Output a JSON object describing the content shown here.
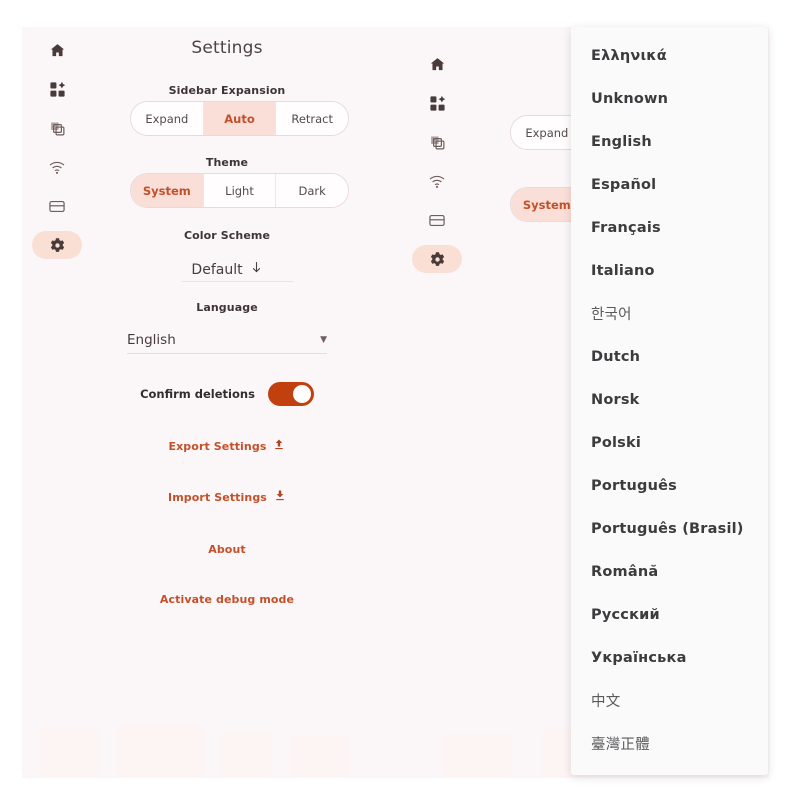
{
  "app": {
    "title": "Settings"
  },
  "sidebar": {
    "items": [
      {
        "name": "home",
        "icon": "home-icon",
        "active": false
      },
      {
        "name": "dashboard",
        "icon": "grid-dashboard-icon",
        "active": false
      },
      {
        "name": "library",
        "icon": "layers-copy-icon",
        "active": false
      },
      {
        "name": "network",
        "icon": "wifi-icon",
        "active": false
      },
      {
        "name": "billing",
        "icon": "credit-card-icon",
        "active": false
      },
      {
        "name": "settings",
        "icon": "gear-icon",
        "active": true
      }
    ]
  },
  "settings": {
    "sidebar_expansion": {
      "label": "Sidebar Expansion",
      "options": [
        "Expand",
        "Auto",
        "Retract"
      ],
      "selected": "Auto"
    },
    "theme": {
      "label": "Theme",
      "options": [
        "System",
        "Light",
        "Dark"
      ],
      "selected": "System"
    },
    "color_scheme": {
      "label": "Color Scheme",
      "value": "Default",
      "icon": "arrow-down-icon"
    },
    "language": {
      "label": "Language",
      "value": "English",
      "caret": "▼"
    },
    "confirm_deletions": {
      "label": "Confirm deletions",
      "enabled": true
    },
    "actions": [
      {
        "label": "Export Settings",
        "icon": "upload-icon"
      },
      {
        "label": "Import Settings",
        "icon": "download-icon"
      },
      {
        "label": "About",
        "icon": null
      },
      {
        "label": "Activate debug mode",
        "icon": null
      }
    ]
  },
  "language_dropdown": {
    "items": [
      {
        "label": "Ελληνικά",
        "cjk": false
      },
      {
        "label": "Unknown",
        "cjk": false
      },
      {
        "label": "English",
        "cjk": false
      },
      {
        "label": "Español",
        "cjk": false
      },
      {
        "label": "Français",
        "cjk": false
      },
      {
        "label": "Italiano",
        "cjk": false
      },
      {
        "label": "한국어",
        "cjk": true
      },
      {
        "label": "Dutch",
        "cjk": false
      },
      {
        "label": "Norsk",
        "cjk": false
      },
      {
        "label": "Polski",
        "cjk": false
      },
      {
        "label": "Português",
        "cjk": false
      },
      {
        "label": "Português (Brasil)",
        "cjk": false
      },
      {
        "label": "Română",
        "cjk": false
      },
      {
        "label": "Русский",
        "cjk": false
      },
      {
        "label": "Українська",
        "cjk": false
      },
      {
        "label": "中文",
        "cjk": true
      },
      {
        "label": "臺灣正體",
        "cjk": true
      }
    ]
  },
  "colors": {
    "accent": "#c4502a",
    "accent_soft": "#fadfd5",
    "toggle_on": "#c2400e",
    "app_background": "#fbf7f8",
    "panel_background": "#fafafa"
  }
}
